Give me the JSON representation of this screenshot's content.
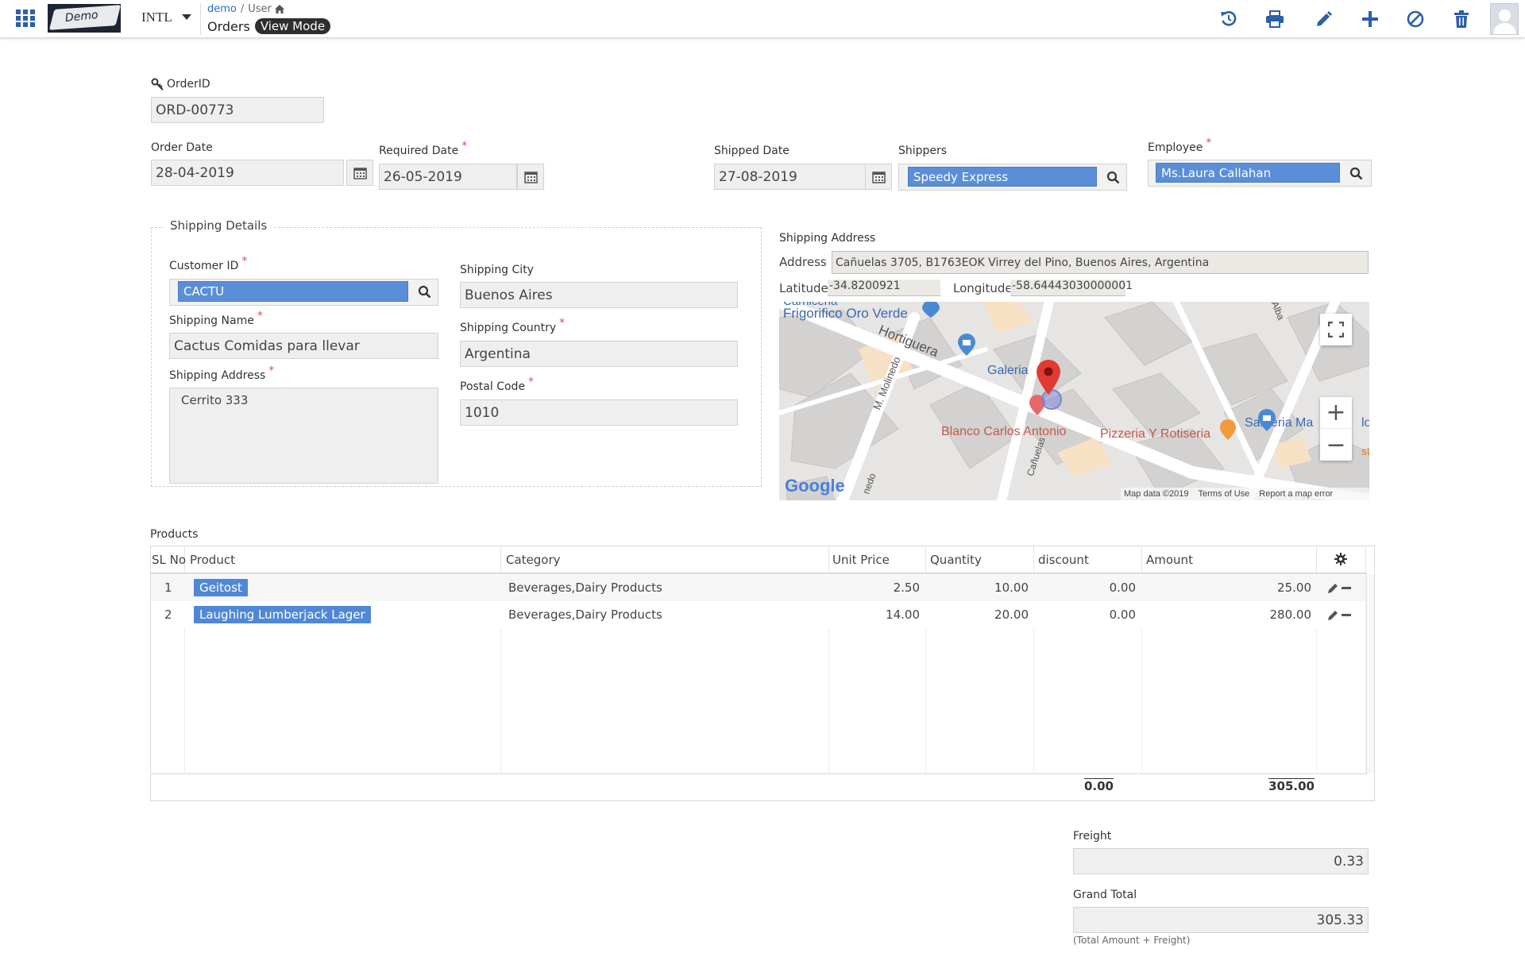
{
  "topbar": {
    "app_label": "INTL",
    "logo_text": "Demo",
    "breadcrumb": {
      "root": "demo",
      "separator": "/",
      "child": "User"
    },
    "page_title": "Orders",
    "mode_badge": "View Mode",
    "actions": [
      "undo",
      "print",
      "edit",
      "add",
      "cancel",
      "delete"
    ]
  },
  "order": {
    "order_id_label": "OrderID",
    "order_id": "ORD-00773",
    "order_date_label": "Order Date",
    "order_date": "28-04-2019",
    "required_date_label": "Required Date",
    "required_date": "26-05-2019",
    "shipped_date_label": "Shipped Date",
    "shipped_date": "27-08-2019",
    "shippers_label": "Shippers",
    "shipper": "Speedy Express",
    "employee_label": "Employee",
    "employee": "Ms.Laura Callahan"
  },
  "shipping": {
    "legend": "Shipping Details",
    "customer_id_label": "Customer ID",
    "customer_id": "CACTU",
    "shipping_name_label": "Shipping Name",
    "shipping_name": "Cactus Comidas para llevar",
    "shipping_address_label": "Shipping Address",
    "shipping_address": "Cerrito 333",
    "city_label": "Shipping City",
    "city": "Buenos Aires",
    "country_label": "Shipping Country",
    "country": "Argentina",
    "postal_label": "Postal Code",
    "postal": "1010"
  },
  "map_section": {
    "title": "Shipping Address",
    "address_label": "Address",
    "address": "Cañuelas 3705, B1763EOK Virrey del Pino, Buenos Aires, Argentina",
    "latitude_label": "Latitude",
    "latitude": "-34.8200921",
    "longitude_label": "Longitude",
    "longitude": "-58.64443030000001",
    "places": {
      "frigorifico": "Frigorifico Oro Verde",
      "carniceria": "Carniceria",
      "hortiguera": "Hortiguera",
      "galeria": "Galeria",
      "molinedo": "M. Molinedo",
      "blanco": "Blanco Carlos Antonio",
      "pizzeria": "Pizzeria Y Rotiseria",
      "santeria": "Santeria Ma",
      "canuelas": "Cañuelas",
      "alba": "Alba",
      "nedo": "nedo",
      "lo": "lo",
      "st": "st"
    },
    "google": "Google",
    "map_data": "Map data ©2019",
    "terms": "Terms of Use",
    "report": "Report a map error",
    "zoom_in": "+",
    "zoom_out": "−"
  },
  "products": {
    "title": "Products",
    "columns": [
      "SL No",
      "Product",
      "Category",
      "Unit Price",
      "Quantity",
      "discount",
      "Amount"
    ],
    "rows": [
      {
        "sl": "1",
        "product": "Geitost",
        "category": "Beverages,Dairy Products",
        "unit_price": "2.50",
        "quantity": "10.00",
        "discount": "0.00",
        "amount": "25.00"
      },
      {
        "sl": "2",
        "product": "Laughing Lumberjack Lager",
        "category": "Beverages,Dairy Products",
        "unit_price": "14.00",
        "quantity": "20.00",
        "discount": "0.00",
        "amount": "280.00"
      }
    ],
    "total_discount": "0.00",
    "total_amount": "305.00"
  },
  "totals": {
    "freight_label": "Freight",
    "freight": "0.33",
    "grand_total_label": "Grand Total",
    "grand_total": "305.33",
    "grand_total_hint": "(Total Amount + Freight)"
  },
  "colors": {
    "accent": "#2c5fa8",
    "tag": "#5b8ed8",
    "badge": "#333333",
    "required": "#d9534f"
  }
}
